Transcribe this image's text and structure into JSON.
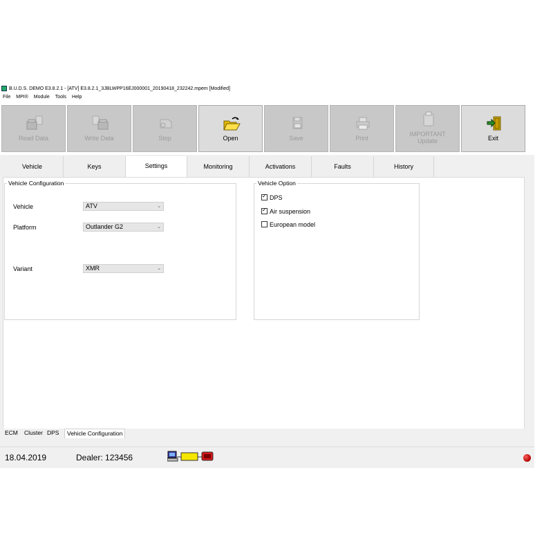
{
  "window": {
    "title": "B.U.D.S. DEMO E3.8.2.1 - [ATV] E3.8.2.1_3JBLWPP16EJ000001_20190418_232242.mpem [Modified]"
  },
  "menu": [
    "File",
    "MPI®",
    "Module",
    "Tools",
    "Help"
  ],
  "toolbar": {
    "buttons": [
      {
        "label": "Read Data",
        "enabled": false,
        "icon": "read-data-icon"
      },
      {
        "label": "Write Data",
        "enabled": false,
        "icon": "write-data-icon"
      },
      {
        "label": "Stop",
        "enabled": false,
        "icon": "stop-icon"
      },
      {
        "label": "Open",
        "enabled": true,
        "icon": "folder-open-icon"
      },
      {
        "label": "Save",
        "enabled": false,
        "icon": "floppy-disk-icon"
      },
      {
        "label": "Print",
        "enabled": false,
        "icon": "printer-icon"
      },
      {
        "label_line1": "IMPORTANT",
        "label_line2": "Update",
        "enabled": false,
        "icon": "update-icon"
      },
      {
        "label": "Exit",
        "enabled": true,
        "icon": "exit-door-icon"
      }
    ]
  },
  "tabs": [
    "Vehicle",
    "Keys",
    "Settings",
    "Monitoring",
    "Activations",
    "Faults",
    "History"
  ],
  "active_tab": "Settings",
  "vehicle_configuration": {
    "title": "Vehicle Configuration",
    "vehicle_label": "Vehicle",
    "vehicle_value": "ATV",
    "platform_label": "Platform",
    "platform_value": "Outlander G2",
    "variant_label": "Variant",
    "variant_value": "XMR"
  },
  "vehicle_option": {
    "title": "Vehicle Option",
    "options": [
      {
        "label": "DPS",
        "checked": true
      },
      {
        "label": "Air suspension",
        "checked": true
      },
      {
        "label": "European model",
        "checked": false
      }
    ]
  },
  "bottom_tabs": [
    "ECM",
    "Cluster",
    "DPS",
    "Vehicle Configuration"
  ],
  "active_bottom_tab": "Vehicle Configuration",
  "status": {
    "date": "18.04.2019",
    "dealer": "Dealer: 123456",
    "indicator_color": "#c00000"
  }
}
